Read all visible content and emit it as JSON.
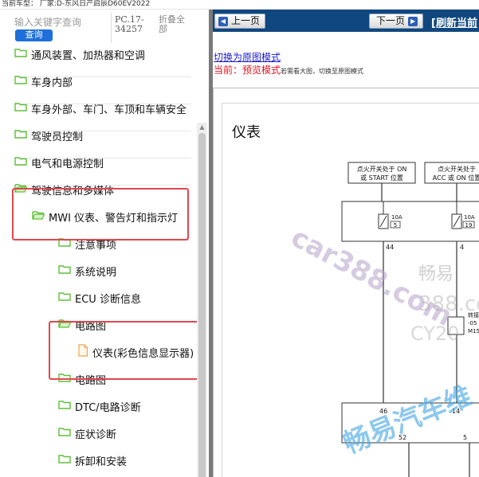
{
  "topbar": {
    "text": "当前车型： 厂家:D-东风日产启辰D60EV2022"
  },
  "search": {
    "placeholder": "输入关键字查询",
    "button": "查询"
  },
  "header": {
    "pc_label": "PC.17-34257",
    "collapse_all": "折叠全部"
  },
  "tree": {
    "items": [
      {
        "label": "通风装置、加热器和空调",
        "icon": "folder-icon"
      },
      {
        "label": "车身内部",
        "icon": "folder-icon"
      },
      {
        "label": "车身外部、车门、车顶和车辆安全",
        "icon": "folder-icon"
      },
      {
        "label": "驾驶员控制",
        "icon": "folder-icon"
      },
      {
        "label": "电气和电源控制",
        "icon": "folder-icon"
      },
      {
        "label": "驾驶信息和多媒体",
        "icon": "folder-open-icon"
      },
      {
        "label": "MWI 仪表、警告灯和指示灯",
        "icon": "folder-open-icon"
      },
      {
        "label": "注意事项",
        "icon": "folder-icon"
      },
      {
        "label": "系统说明",
        "icon": "folder-icon"
      },
      {
        "label": "ECU 诊断信息",
        "icon": "folder-icon"
      },
      {
        "label": "电路图",
        "icon": "folder-open-icon"
      },
      {
        "label": "仪表(彩色信息显示器)",
        "icon": "document-icon"
      },
      {
        "label": "电路图",
        "icon": "folder-icon"
      },
      {
        "label": "DTC/电路诊断",
        "icon": "folder-icon"
      },
      {
        "label": "症状诊断",
        "icon": "folder-icon"
      },
      {
        "label": "拆卸和安装",
        "icon": "folder-icon"
      }
    ]
  },
  "nav": {
    "prev": "上一页",
    "next": "下一页",
    "refresh": "[刷新当前"
  },
  "viewer": {
    "switch_link": "切换为原图模式",
    "current_label": "当前：",
    "current_mode": "预览模式",
    "mode_hint": "若需看大图，切换至原图模式",
    "doc_title": "仪表"
  },
  "diagram": {
    "box1": [
      "点火开关处于 ON",
      "或 START 位置"
    ],
    "box2": [
      "点火开关处于",
      "ACC 或 ON 位置"
    ],
    "fuse1": {
      "amp": "10A",
      "num": "5"
    },
    "fuse2": {
      "amp": "10A",
      "num": "19"
    },
    "side_text": [
      "转接",
      "-05",
      "M15"
    ],
    "pins": [
      "44",
      "4",
      "46",
      "14",
      "52",
      "5"
    ]
  },
  "watermarks": [
    "car388.com",
    "畅易",
    "388.co",
    "CY20",
    "畅易汽车维"
  ],
  "colors": {
    "nav_bg": "#10477e",
    "folder": "#5fbf3a",
    "highlight": "#e0474f",
    "link": "#1a1ad0",
    "mode_red": "#e0141e",
    "button_blue": "#1e6fd9"
  }
}
